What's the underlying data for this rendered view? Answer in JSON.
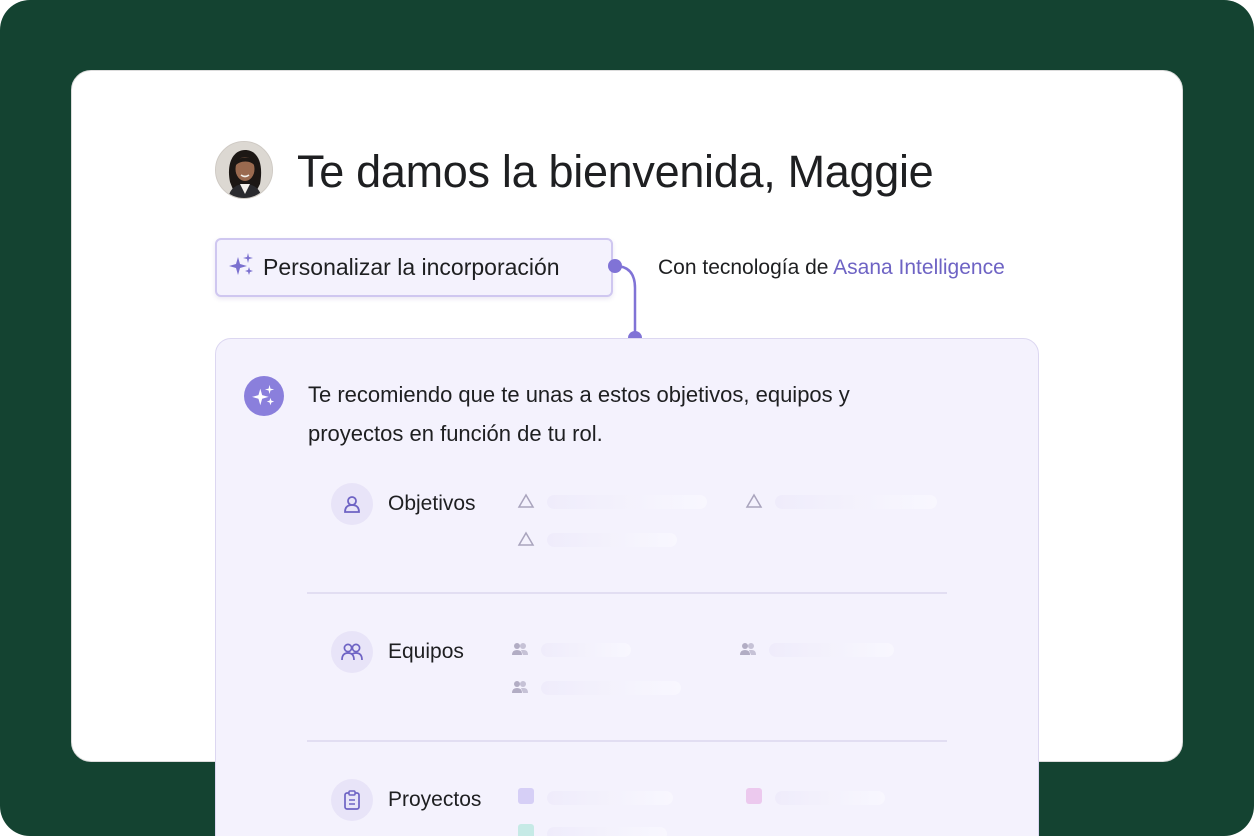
{
  "welcome": {
    "title": "Te damos la bienvenida, Maggie",
    "avatar_icon": "user-avatar-photo"
  },
  "personalize_button": {
    "label": "Personalizar la incorporación",
    "icon": "sparkles-icon"
  },
  "powered_by": {
    "prefix": "Con tecnología de",
    "brand": "Asana Intelligence",
    "brand_color": "#6e63c4"
  },
  "recommendation": {
    "icon": "ai-sparkles-icon",
    "message": "Te recomiendo que te unas a estos objetivos, equipos y proyectos en función de tu rol."
  },
  "sections": [
    {
      "label": "Objetivos",
      "icon": "goal-icon",
      "item_icon": "triangle-icon"
    },
    {
      "label": "Equipos",
      "icon": "team-icon",
      "item_icon": "people-icon"
    },
    {
      "label": "Proyectos",
      "icon": "project-clipboard-icon",
      "item_icon": "project-color-square"
    }
  ],
  "colors": {
    "background": "#144331",
    "accent": "#8a7fdc",
    "panel": "#f4f2fd"
  }
}
